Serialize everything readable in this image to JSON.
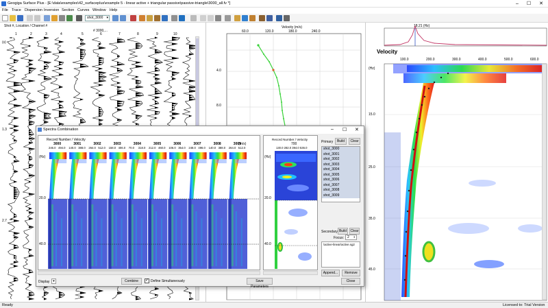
{
  "window": {
    "title": "Geogiga Surface Plus - [E:\\data\\examples\\42_surfaceplus\\example 5 - linear active + triangular passive\\passive-triangle\\3000_all.fv *]",
    "min": "–",
    "max": "☐",
    "close": "✕"
  },
  "menu": [
    "File",
    "Trace",
    "Dispersion",
    "Inversion",
    "Section",
    "Curves",
    "Window",
    "Help"
  ],
  "toolbar": {
    "shot_select": "shot_3000"
  },
  "status": {
    "left": "Ready",
    "right": "Licensed to: Trial Version"
  },
  "trace_panel": {
    "header": "Shot #, Location / Channel #",
    "selected": "# 3000,...",
    "channels": [
      "1",
      "2",
      "3",
      "4",
      "5",
      "6",
      "7",
      "8",
      "9",
      "10"
    ],
    "time_ticks": [
      "(s)",
      "1.3",
      "2.7"
    ]
  },
  "velocity_panel": {
    "title": "Velocity (m/s)",
    "x_ticks": [
      "60.0",
      "120.0",
      "180.0",
      "240.0"
    ],
    "y_ticks": [
      "4.0",
      "8.0"
    ]
  },
  "spectrum_panel": {
    "top_label": "18.21 (Hz)",
    "title": "Velocity",
    "x_ticks": [
      "100.0",
      "200.0",
      "300.0",
      "400.0",
      "500.0",
      "600.0"
    ],
    "y_ticks": [
      "(Hz)",
      "15.0",
      "25.0",
      "35.0",
      "45.0"
    ]
  },
  "dialog": {
    "title": "Spectra Combination",
    "record_label": "Record Number / Velocity",
    "unit": "(m/s)",
    "records": [
      "3000",
      "3001",
      "3002",
      "3003",
      "3004",
      "3005",
      "3006",
      "3007",
      "3008",
      "3009"
    ],
    "velocity_subticks": [
      "246.0",
      "494.0",
      "140.0",
      "388.0",
      "264.0",
      "512.0",
      "158.0",
      "406.0",
      "70.0",
      "318.0",
      "212.0",
      "460.0",
      "106.0",
      "354.0",
      "248.0",
      "496.0",
      "140.0",
      "388.0",
      "264.0",
      "512.0"
    ],
    "freq_ticks": [
      "(Hz)",
      "20.0",
      "40.0"
    ],
    "right_record_label": "Record Number / Velocity",
    "right_record": "700",
    "right_subticks": "130.0 282.0 394.0 536.0",
    "right_freq_ticks": [
      "(Hz)",
      "20.0",
      "40.0"
    ],
    "primary": {
      "label": "Primary",
      "build": "Build",
      "clear": "Clear",
      "items": [
        "shot_3000",
        "shot_3001",
        "shot_3002",
        "shot_3003",
        "shot_3004",
        "shot_3005",
        "shot_3006",
        "shot_3007",
        "shot_3008",
        "shot_3009"
      ]
    },
    "secondary": {
      "label": "Secondary",
      "build": "Build",
      "clear": "Clear",
      "focus_label": "Focus:",
      "focus_value": "2",
      "items": [
        "\\active-linear\\active.sg2"
      ],
      "append": "Append...",
      "remove": "Remove"
    },
    "display_label": "Display",
    "combine": "Combine",
    "define_simultaneously": "Define Simultaneously",
    "save_parameters": "Save Parameters",
    "close": "Close"
  }
}
